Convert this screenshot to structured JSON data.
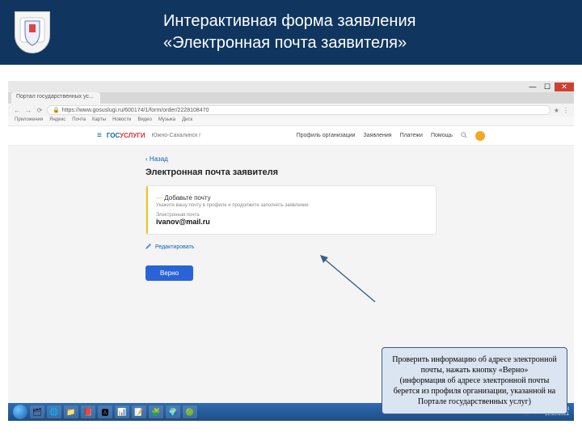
{
  "slide": {
    "title_line1": "Интерактивная форма заявления",
    "title_line2": "«Электронная почта заявителя»"
  },
  "browser": {
    "tab_title": "Портал государственных ус...",
    "url": "https://www.gosuslugi.ru/600174/1/form/order/2228108470",
    "bookmarks": [
      "Приложения",
      "Яндекс",
      "Почта",
      "Карты",
      "Новости",
      "Видео",
      "Музыка",
      "Диск"
    ],
    "win_min": "—",
    "win_max": "☐",
    "win_close": "✕",
    "nav_back": "←",
    "nav_fwd": "→",
    "nav_reload": "⟳",
    "menu": "⋮",
    "ext": "★"
  },
  "gos": {
    "hamburger": "≡",
    "logo1": "ГОС",
    "logo2": "УСЛУГИ",
    "city": "Южно-Сахалинск г",
    "nav": [
      "Профиль организации",
      "Заявления",
      "Платежи",
      "Помощь"
    ],
    "back": "‹ Назад",
    "page_title": "Электронная почта заявителя",
    "card_head": "Добавьте почту",
    "card_hint": "Укажите вашу почту в профиле и продолжите заполнять заявление",
    "field_label": "Электронная почта",
    "field_value": "ivanov@mail.ru",
    "edit": "Редактировать",
    "button": "Верно"
  },
  "callout": {
    "line1": "Проверить информацию об адресе электронной почты, нажать кнопку «Верно»",
    "line2": "(информация об адресе электронной почты берется из профиля организации, указанной на Портале государственных услуг)"
  },
  "taskbar": {
    "icons": [
      "🗂",
      "🌐",
      "📁",
      "📕",
      "🅰",
      "📊",
      "📝",
      "🧩",
      "🌍",
      "🟢"
    ],
    "lang": "RU",
    "time": "12:53",
    "date": "19.10.2021"
  }
}
